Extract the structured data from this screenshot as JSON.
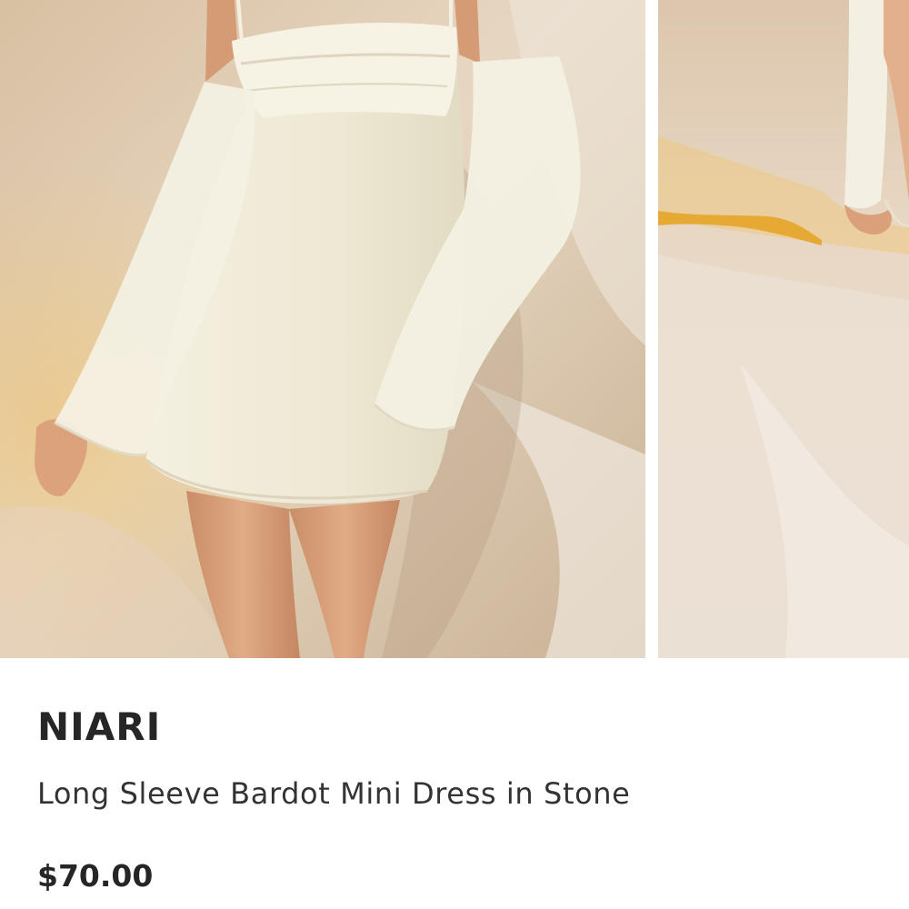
{
  "product": {
    "brand": "NIARI",
    "name": "Long Sleeve Bardot Mini Dress in Stone",
    "price": "$70.00"
  },
  "gallery": {
    "images": [
      {
        "alt": "model-wearing-stone-mini-dress-front"
      },
      {
        "alt": "model-wearing-stone-mini-dress-side"
      }
    ],
    "colors": {
      "backdrop": "#d9c3a6",
      "dress": "#f1ecda",
      "skin": "#d9a37c",
      "accent": "#e8b443"
    }
  }
}
